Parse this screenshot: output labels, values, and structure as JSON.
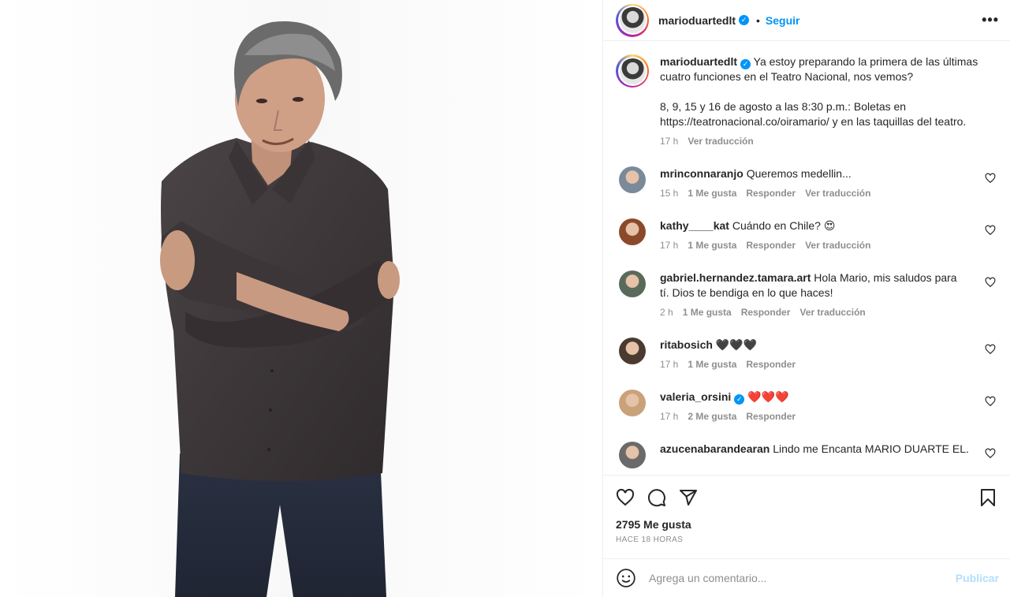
{
  "post": {
    "username": "marioduartedlt",
    "follow_label": "Seguir",
    "more_icon": "more-horizontal-icon",
    "photo_description_icon": "portrait-photo"
  },
  "caption": {
    "username": "marioduartedlt",
    "text": "Ya estoy preparando la primera de las últimas cuatro funciones en el Teatro Nacional, nos vemos?\n\n8, 9, 15 y 16 de agosto a las 8:30 p.m.: Boletas en https://teatronacional.co/oiramario/ y en las taquillas del teatro.",
    "time": "17 h",
    "translate_label": "Ver traducción"
  },
  "comments": [
    {
      "username": "mrinconnaranjo",
      "text": "Queremos medellin...",
      "time": "15 h",
      "likes": "1 Me gusta",
      "reply": "Responder",
      "translate": "Ver traducción",
      "avatar_color": "#7a8a9a"
    },
    {
      "username": "kathy____kat",
      "text": "Cuándo en Chile? 😍",
      "time": "17 h",
      "likes": "1 Me gusta",
      "reply": "Responder",
      "translate": "Ver traducción",
      "avatar_color": "#8a4a2a"
    },
    {
      "username": "gabriel.hernandez.tamara.art",
      "text": "Hola Mario, mis saludos para tí. Dios te bendiga en lo que haces!",
      "time": "2 h",
      "likes": "1 Me gusta",
      "reply": "Responder",
      "translate": "Ver traducción",
      "avatar_color": "#5a6a5a"
    },
    {
      "username": "ritabosich",
      "text": "🖤🖤🖤",
      "time": "17 h",
      "likes": "1 Me gusta",
      "reply": "Responder",
      "translate": "",
      "avatar_color": "#4a3a30"
    },
    {
      "username": "valeria_orsini",
      "text": "❤️❤️❤️",
      "time": "17 h",
      "likes": "2 Me gusta",
      "reply": "Responder",
      "translate": "",
      "avatar_color": "#c9a27a",
      "verified": true
    },
    {
      "username": "azucenabarandearan",
      "text": "Lindo me Encanta MARIO DUARTE EL.",
      "time": "",
      "likes": "",
      "reply": "",
      "translate": "",
      "avatar_color": "#6a6a6a"
    }
  ],
  "actions": {
    "like_icon": "heart-icon",
    "comment_icon": "comment-icon",
    "share_icon": "send-icon",
    "save_icon": "bookmark-icon",
    "likes_count": "2795 Me gusta",
    "posted_ago": "HACE 18 HORAS"
  },
  "add_comment": {
    "placeholder": "Agrega un comentario...",
    "publish_label": "Publicar",
    "emoji_icon": "emoji-smile-icon"
  },
  "colors": {
    "accent": "#0095f6",
    "muted": "#8e8e8e",
    "publish_disabled": "#b2dffc"
  }
}
